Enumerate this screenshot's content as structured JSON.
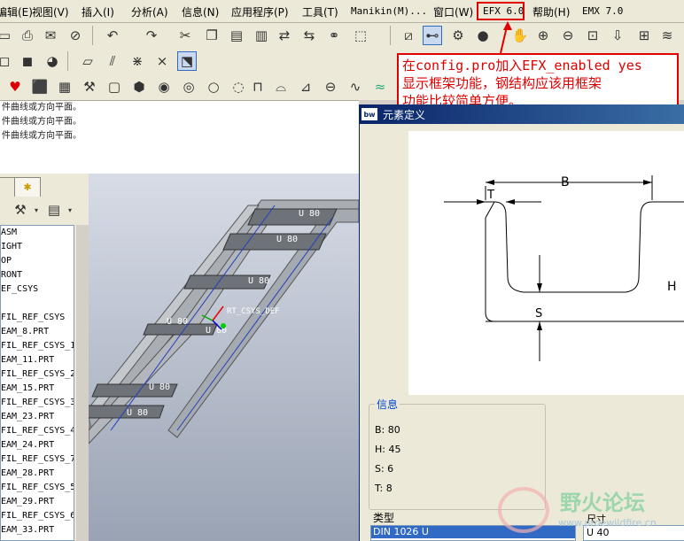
{
  "menu": {
    "items": [
      "编辑(E)",
      "视图(V)",
      "插入(I)",
      "分析(A)",
      "信息(N)",
      "应用程序(P)",
      "工具(T)",
      "Manikin(M)...",
      "窗口(W)",
      "EFX 6.0",
      "帮助(H)",
      "EMX 7.0"
    ],
    "highlight_color": "#e00000"
  },
  "callout": {
    "line1": "在config.pro加入EFX_enabled yes",
    "line2": "显示框架功能，钢结构应该用框架",
    "line3": "功能比较简单方便。"
  },
  "messages": [
    "件曲线或方向平面。",
    "件曲线或方向平面。",
    "件曲线或方向平面。"
  ],
  "tree": {
    "items_a": [
      "ASM",
      "IGHT",
      "OP",
      "RONT",
      "EF_CSYS"
    ],
    "items_b": [
      "FIL_REF_CSYS",
      "EAM_8.PRT",
      "FIL_REF_CSYS_1",
      "EAM_11.PRT",
      "FIL_REF_CSYS_2",
      "EAM_15.PRT",
      "FIL_REF_CSYS_3",
      "EAM_23.PRT",
      "FIL_REF_CSYS_4",
      "EAM_24.PRT",
      "FIL_REF_CSYS_7",
      "EAM_28.PRT",
      "FIL_REF_CSYS_5",
      "EAM_29.PRT",
      "FIL_REF_CSYS_6",
      "EAM_33.PRT"
    ]
  },
  "viewport": {
    "beam_label": "U 80",
    "csys_label": "RT_CSYS_DEF"
  },
  "dialog": {
    "title": "元素定义",
    "icon_text": "bw",
    "dims": {
      "B": "B",
      "T": "T",
      "H": "H",
      "S": "S"
    },
    "info": {
      "title": "信息",
      "rows": [
        "B: 80",
        "H: 45",
        "S: 6",
        "T: 8"
      ]
    },
    "type_label": "类型",
    "type_selected": "DIN 1026 U",
    "size_label": "尺寸",
    "size_value": "U 40"
  },
  "watermark": {
    "title": "野火论坛",
    "url": "www.proewildfire.cn"
  }
}
